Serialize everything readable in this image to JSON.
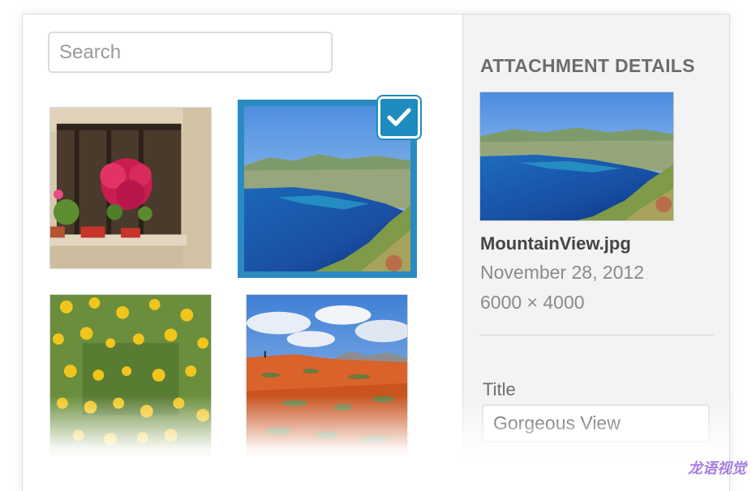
{
  "search": {
    "placeholder": "Search",
    "value": ""
  },
  "grid": {
    "items": [
      {
        "name": "window-flowers",
        "selected": false
      },
      {
        "name": "MountainView.jpg",
        "selected": true
      },
      {
        "name": "yellow-flowers",
        "selected": false
      },
      {
        "name": "red-field",
        "selected": false
      }
    ],
    "selected_check_icon": "checkmark-icon"
  },
  "details": {
    "heading": "ATTACHMENT DETAILS",
    "filename": "MountainView.jpg",
    "date": "November 28, 2012",
    "dimensions": "6000 × 4000"
  },
  "fields": {
    "title_label": "Title",
    "title_value": "Gorgeous View"
  },
  "watermark": "龙语视觉",
  "colors": {
    "accent": "#2a8bc2",
    "check_bg": "#1e8cbe"
  }
}
